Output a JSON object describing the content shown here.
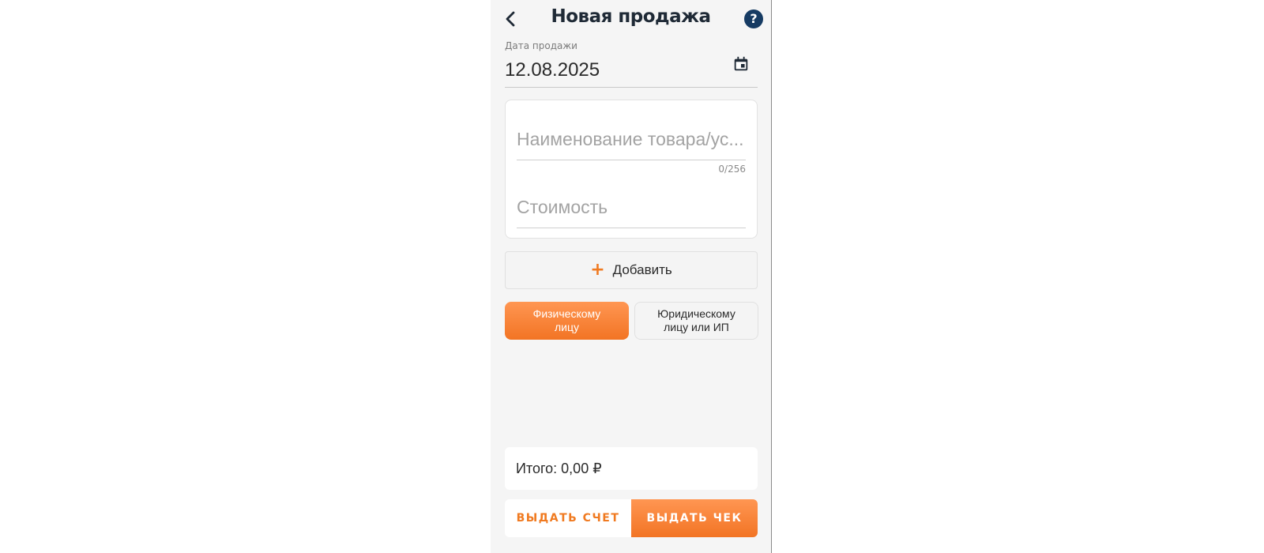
{
  "header": {
    "title": "Новая продажа",
    "back_icon": "chevron-left-icon",
    "help_label": "?"
  },
  "date": {
    "label": "Дата продажи",
    "value": "12.08.2025",
    "icon": "calendar-icon"
  },
  "item": {
    "name_placeholder": "Наименование товара/ус...",
    "name_value": "",
    "counter": "0/256",
    "price_placeholder": "Стоимость",
    "price_value": ""
  },
  "add_button": {
    "icon": "+",
    "label": "Добавить"
  },
  "buyer_type": {
    "options": [
      {
        "label": "Физическому\nлицу",
        "selected": true
      },
      {
        "label": "Юридическому\nлицу или ИП",
        "selected": false
      }
    ]
  },
  "total": {
    "text": "Итого: 0,00 ₽"
  },
  "actions": {
    "invoice_label": "ВЫДАТЬ СЧЕТ",
    "receipt_label": "ВЫДАТЬ ЧЕК"
  },
  "colors": {
    "accent": "#f27424",
    "help_bg": "#163b63",
    "background": "#f5f5f5"
  }
}
